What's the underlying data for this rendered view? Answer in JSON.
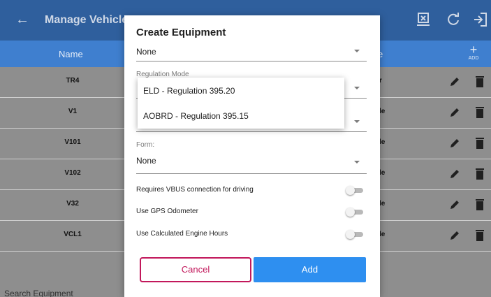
{
  "appbar": {
    "back_icon": "arrow-left-icon",
    "title": "Manage Vehicles",
    "icons": [
      "sync-device-icon",
      "refresh-icon",
      "logout-icon"
    ]
  },
  "table": {
    "col_name": "Name",
    "col_type_partial": "e",
    "add_label": "ADD",
    "rows": [
      {
        "name": "TR4",
        "type": "r"
      },
      {
        "name": "V1",
        "type": "le"
      },
      {
        "name": "V101",
        "type": "le"
      },
      {
        "name": "V102",
        "type": "le"
      },
      {
        "name": "V32",
        "type": "le"
      },
      {
        "name": "VCL1",
        "type": "le"
      }
    ]
  },
  "search": {
    "label": "Search Equipment"
  },
  "dialog": {
    "title": "Create Equipment",
    "first_select_value": "None",
    "regulation_label": "Regulation Mode",
    "form_label": "Form:",
    "form_value": "None",
    "toggles": [
      {
        "label": "Requires VBUS connection for driving",
        "on": false
      },
      {
        "label": "Use GPS Odometer",
        "on": false
      },
      {
        "label": "Use Calculated Engine Hours",
        "on": false
      }
    ],
    "cancel_label": "Cancel",
    "add_label": "Add"
  },
  "regulation_dropdown": {
    "options": [
      "ELD - Regulation 395.20",
      "AOBRD - Regulation 395.15"
    ]
  },
  "colors": {
    "appbar": "#2f5f9d",
    "table_header": "#3f7fcf",
    "cancel_accent": "#c2185b",
    "add_button": "#2e8ff0"
  }
}
